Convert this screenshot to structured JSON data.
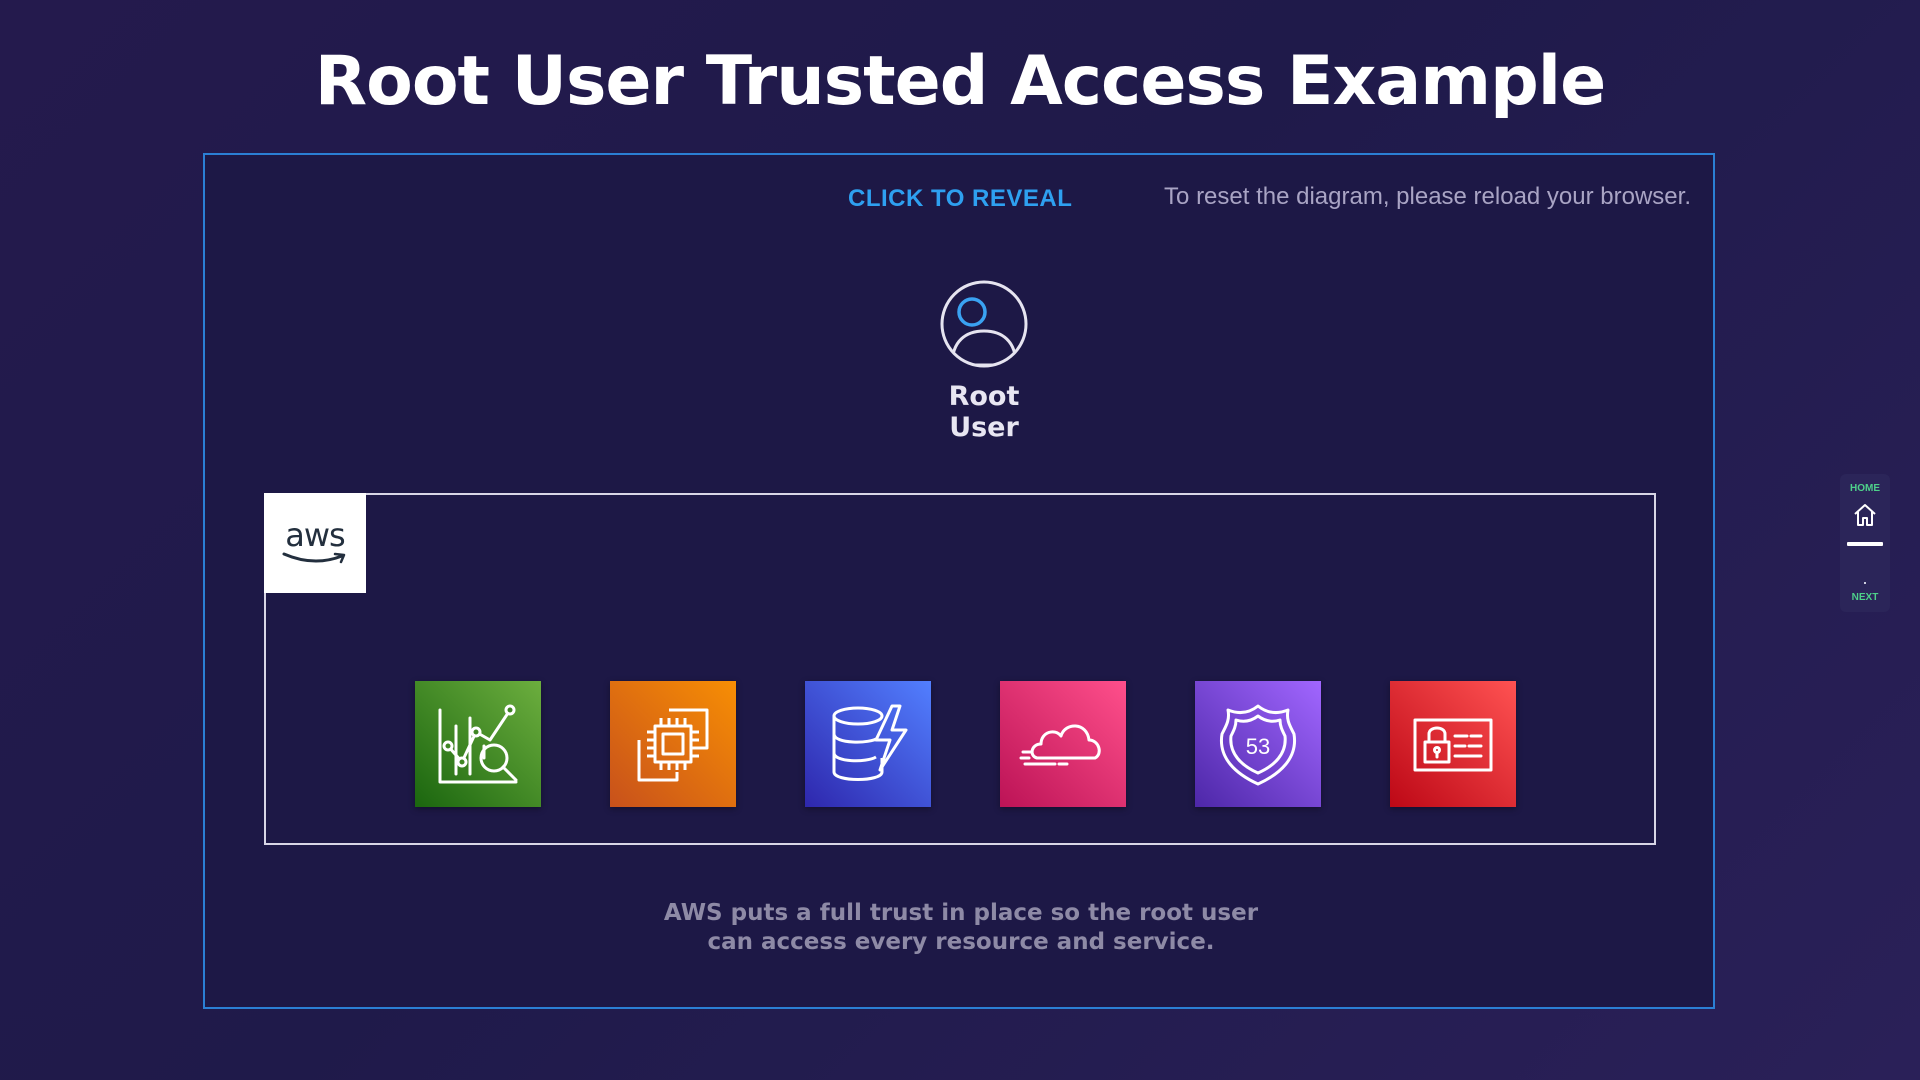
{
  "page": {
    "title": "Root User Trusted Access Example"
  },
  "diagram": {
    "reveal_label": "CLICK TO REVEAL",
    "reset_note": "To reset the diagram, please reload your browser.",
    "root_user": {
      "icon": "user-icon",
      "label": "Root User"
    },
    "aws_logo": {
      "text": "aws",
      "icon": "aws-logo"
    },
    "services": [
      {
        "icon": "analytics-search-icon",
        "color": "#3f8624"
      },
      {
        "icon": "chip-compute-icon",
        "color": "#e7701d"
      },
      {
        "icon": "database-lightning-icon",
        "color": "#3b48cc"
      },
      {
        "icon": "cloud-speed-icon",
        "color": "#e7157b"
      },
      {
        "icon": "route53-shield-icon",
        "color": "#8c4fff",
        "badge": "53"
      },
      {
        "icon": "identity-lock-card-icon",
        "color": "#dd344c"
      }
    ],
    "caption_line1": "AWS puts a full trust in place so the root user",
    "caption_line2": "can access every resource and service."
  },
  "nav": {
    "home_label": "HOME",
    "home_icon": "home-icon",
    "next_label": "NEXT"
  },
  "colors": {
    "background": "#231b4c",
    "panel": "#1d1846",
    "panel_border": "#2b7fd4",
    "accent_blue": "#2ea0f0",
    "nav_green": "#4ed08a"
  }
}
